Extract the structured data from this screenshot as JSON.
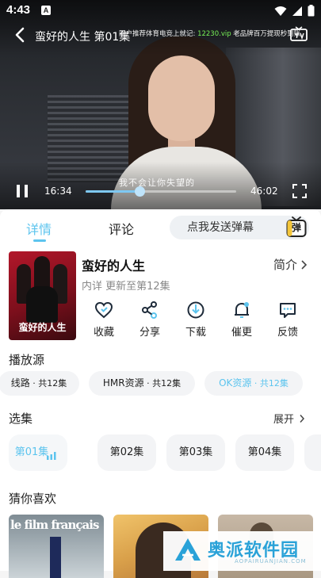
{
  "status_bar": {
    "time": "4:43",
    "notification_letter": "A"
  },
  "player": {
    "title": "蛮好的人生 第01集",
    "ad_text_prefix": "同户推荐体育电竞上就记: ",
    "ad_highlight": "12230.vip",
    "ad_text_suffix": " 老品牌百万提现秒到账",
    "subtitle": "我不会让你失望的",
    "current_time": "16:34",
    "total_time": "46:02",
    "progress_fraction": 0.36,
    "accent": "#7ec8f2"
  },
  "tabs": {
    "details": "详情",
    "comments": "评论",
    "danmu_placeholder": "点我发送弹幕",
    "danmu_button": "弹"
  },
  "show": {
    "title": "蛮好的人生",
    "intro_link": "简介",
    "meta": "内详 更新至第12集",
    "poster_caption": "蛮好的人生"
  },
  "actions": [
    {
      "label": "收藏",
      "icon": "heart-icon"
    },
    {
      "label": "分享",
      "icon": "share-icon"
    },
    {
      "label": "下载",
      "icon": "download-icon"
    },
    {
      "label": "催更",
      "icon": "bell-icon"
    },
    {
      "label": "反馈",
      "icon": "feedback-icon"
    }
  ],
  "sources": {
    "heading": "播放源",
    "items": [
      {
        "name": "线路",
        "count": " · 共12集"
      },
      {
        "name": "HMR资源",
        "count": " · 共12集"
      },
      {
        "name": "OK资源",
        "count": " · 共12集"
      }
    ]
  },
  "episodes": {
    "heading": "选集",
    "expand": "展开",
    "items": [
      "第01集",
      "第02集",
      "第03集",
      "第04集"
    ]
  },
  "guess": {
    "heading": "猜你喜欢",
    "thumb_1_title": "le film français"
  },
  "watermark": {
    "text": "奥派软件园",
    "sub": "AOPAIRUANJIAN.COM"
  },
  "colors": {
    "accent": "#5cc4ee",
    "brand": "#2aa2d8"
  }
}
